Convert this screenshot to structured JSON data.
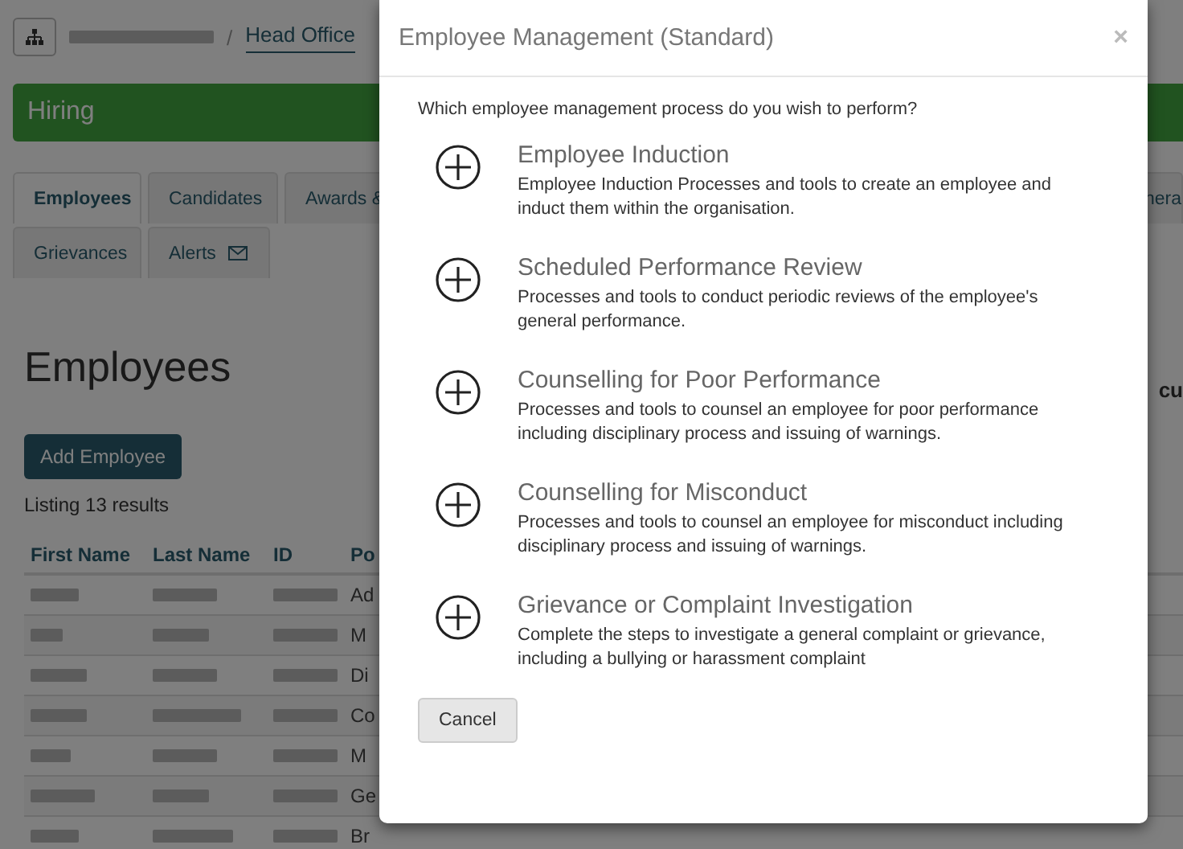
{
  "breadcrumb": {
    "separator": "/",
    "current": "Head Office"
  },
  "banner": {
    "title": "Hiring"
  },
  "tabs": [
    {
      "label": "Employees",
      "selected": true,
      "kind": "plain"
    },
    {
      "label": "Candidates",
      "selected": false,
      "kind": "plain"
    },
    {
      "label": "Awards &",
      "selected": false,
      "kind": "plain"
    },
    {
      "label": "nera",
      "selected": false,
      "kind": "plain"
    },
    {
      "label": "Grievances",
      "selected": false,
      "kind": "plain"
    },
    {
      "label": "Alerts",
      "selected": false,
      "kind": "mail"
    }
  ],
  "page": {
    "heading": "Employees",
    "side_text": "cu",
    "add_button": "Add Employee",
    "listing": "Listing 13 results"
  },
  "table": {
    "columns": [
      "First Name",
      "Last Name",
      "ID",
      "Po"
    ],
    "rows": [
      {
        "position": "Ad"
      },
      {
        "position": "M"
      },
      {
        "position": "Di"
      },
      {
        "position": "Co"
      },
      {
        "position": "M"
      },
      {
        "position": "Ge"
      },
      {
        "position": "Br"
      }
    ]
  },
  "modal": {
    "title": "Employee Management (Standard)",
    "close": "×",
    "prompt": "Which employee management process do you wish to perform?",
    "options": [
      {
        "title": "Employee Induction",
        "description": "Employee Induction Processes and tools to create an employee and induct them within the organisation."
      },
      {
        "title": "Scheduled Performance Review",
        "description": "Processes and tools to conduct periodic reviews of the employee's general performance."
      },
      {
        "title": "Counselling for Poor Performance",
        "description": "Processes and tools to counsel an employee for poor performance including disciplinary process and issuing of warnings."
      },
      {
        "title": "Counselling for Misconduct",
        "description": "Processes and tools to counsel an employee for misconduct including disciplinary process and issuing of warnings."
      },
      {
        "title": "Grievance or Complaint Investigation",
        "description": "Complete the steps to investigate a general complaint or grievance, including a bullying or harassment complaint"
      }
    ],
    "cancel": "Cancel"
  }
}
